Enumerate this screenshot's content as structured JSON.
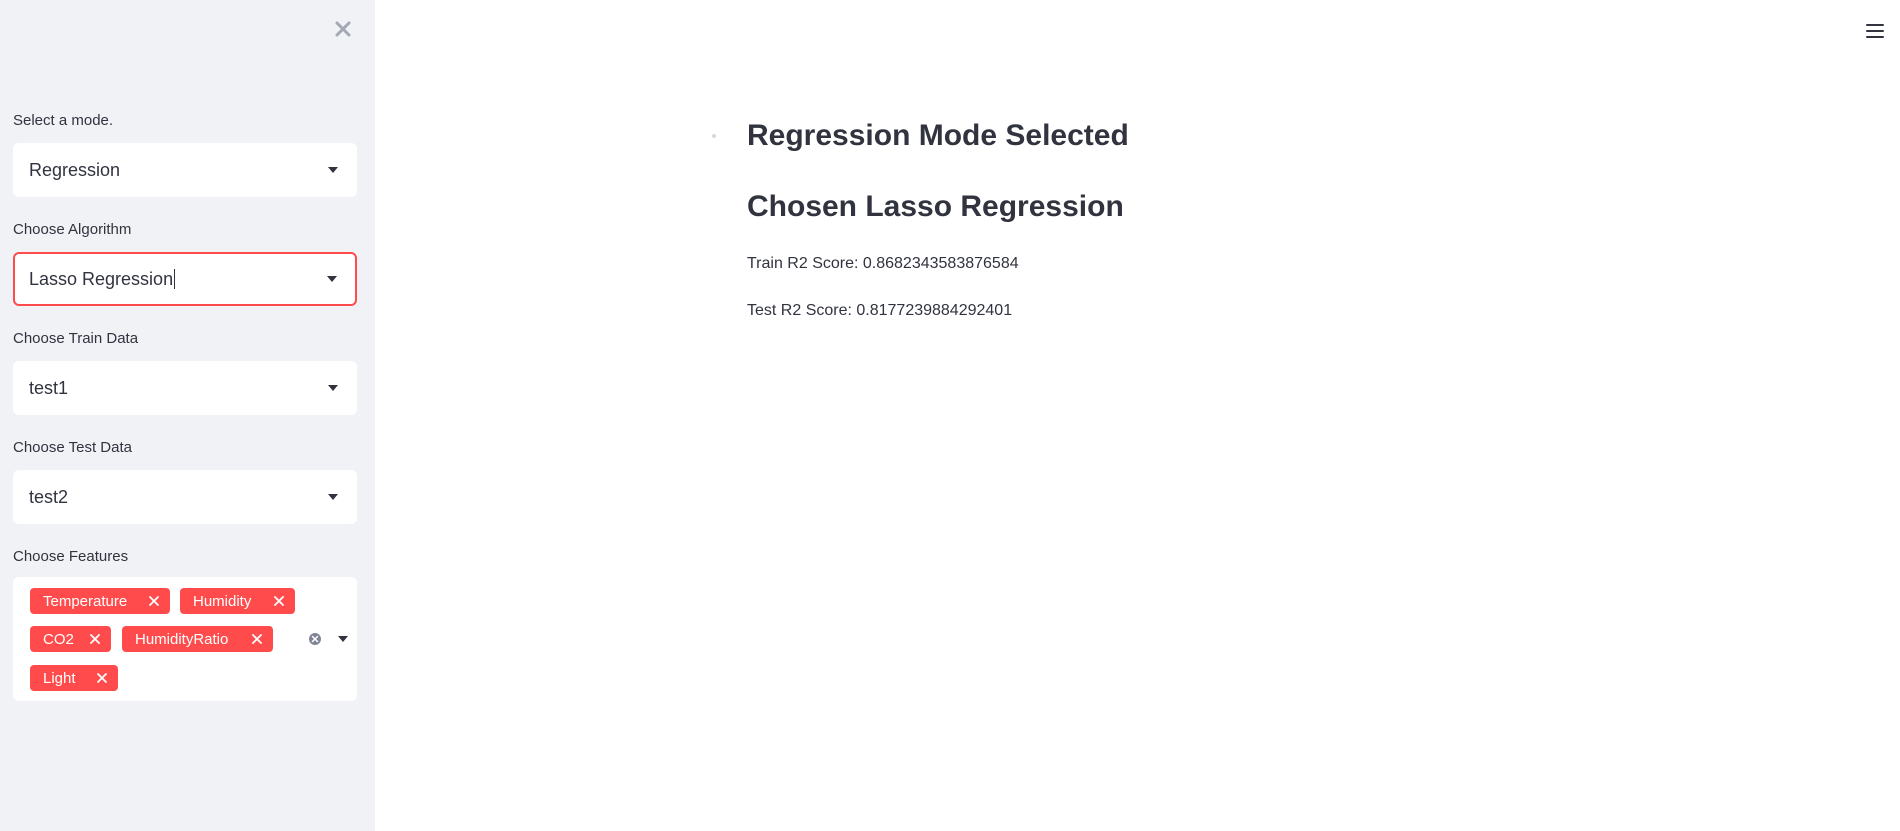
{
  "sidebar": {
    "mode": {
      "label": "Select a mode.",
      "value": "Regression"
    },
    "algorithm": {
      "label": "Choose Algorithm",
      "value": "Lasso Regression"
    },
    "train_data": {
      "label": "Choose Train Data",
      "value": "test1"
    },
    "test_data": {
      "label": "Choose Test Data",
      "value": "test2"
    },
    "features": {
      "label": "Choose Features",
      "tags": [
        "Temperature",
        "Humidity",
        "CO2",
        "HumidityRatio",
        "Light"
      ]
    }
  },
  "main": {
    "heading1": "Regression Mode Selected",
    "heading2": "Chosen Lasso Regression",
    "train_score": "Train R2 Score: 0.8682343583876584",
    "test_score": "Test R2 Score: 0.8177239884292401"
  },
  "icons": {
    "close": "close-icon",
    "menu": "hamburger-menu-icon",
    "dropdown": "chevron-down-icon",
    "tag_remove": "close-icon",
    "clear_all": "clear-circle-icon"
  },
  "colors": {
    "accent": "#ff4b4b",
    "sidebar_bg": "#f0f2f6",
    "text": "#31333f"
  }
}
